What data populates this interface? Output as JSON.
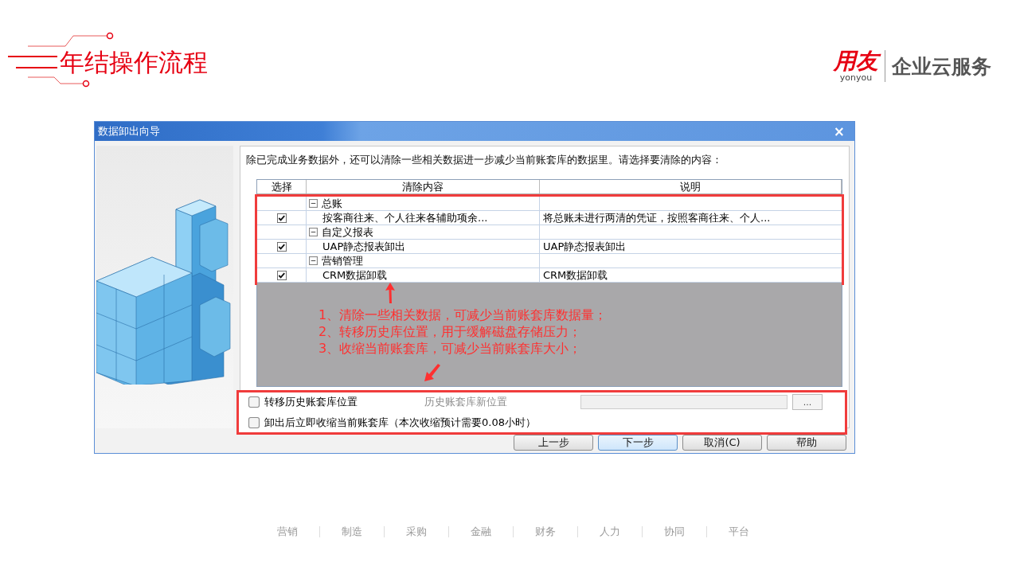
{
  "slide_title": "年结操作流程",
  "logo": {
    "brand": "用友",
    "brand_sub": "yonyou",
    "tagline": "企业云服务"
  },
  "dialog": {
    "title": "数据卸出向导",
    "close": "×",
    "instruction": "除已完成业务数据外，还可以清除一些相关数据进一步减少当前账套库的数据里。请选择要清除的内容：",
    "table": {
      "columns": [
        "选择",
        "清除内容",
        "说明"
      ],
      "groups": [
        {
          "name": "总账",
          "expanded": true,
          "items": [
            {
              "checked": true,
              "content": "按客商往来、个人往来各辅助项余...",
              "description": "将总账未进行两清的凭证，按照客商往来、个人..."
            }
          ]
        },
        {
          "name": "自定义报表",
          "expanded": true,
          "items": [
            {
              "checked": true,
              "content": "UAP静态报表卸出",
              "description": "UAP静态报表卸出"
            }
          ]
        },
        {
          "name": "营销管理",
          "expanded": true,
          "items": [
            {
              "checked": true,
              "content": "CRM数据卸载",
              "description": "CRM数据卸载"
            }
          ]
        }
      ]
    },
    "annotations": [
      "1、清除一些相关数据，可减少当前账套库数据量；",
      "2、转移历史库位置，用于缓解磁盘存储压力；",
      "3、收缩当前账套库，可减少当前账套库大小；"
    ],
    "options": [
      {
        "label": "转移历史账套库位置",
        "checked": false
      },
      {
        "label": "卸出后立即收缩当前账套库（本次收缩预计需要0.08小时）",
        "checked": false
      }
    ],
    "location": {
      "label": "历史账套库新位置",
      "disabled": true,
      "browse": "..."
    },
    "buttons": [
      {
        "label": "上一步",
        "focused": false
      },
      {
        "label": "下一步",
        "focused": true
      },
      {
        "label": "取消(C)",
        "focused": false
      },
      {
        "label": "帮助",
        "focused": false
      }
    ]
  },
  "footer_nav": [
    "营销",
    "制造",
    "采购",
    "金融",
    "财务",
    "人力",
    "协同",
    "平台"
  ]
}
